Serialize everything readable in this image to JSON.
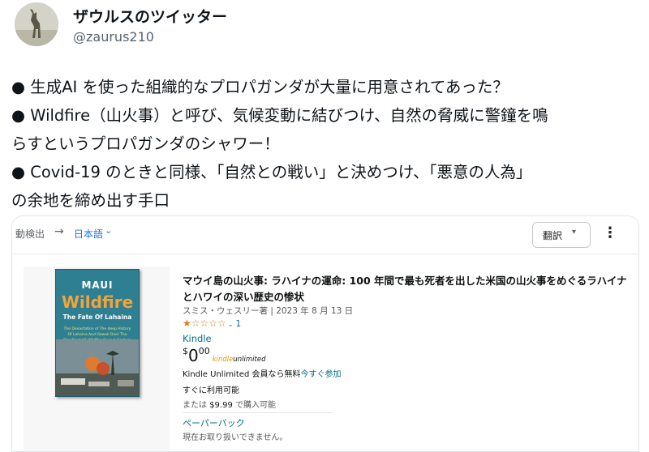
{
  "tweet": {
    "display_name": "ザウルスのツイッター",
    "handle": "@zaurus210",
    "lines": [
      "● 生成AI を使った組織的なプロパガンダが大量に用意されてあった？",
      "● Wildfire（山火事）と呼び、気候変動に結びつけ、自然の脅威に警鐘を鳴",
      "らすというプロパガンダのシャワー！",
      "● Covid-19 のときと同様、「自然との戦い」と決めつけ、「悪意の人為」",
      "の余地を締め出す手口"
    ]
  },
  "embed": {
    "toolbar": {
      "detect_label": "動検出",
      "arrow": "→",
      "language": "日本語",
      "translate_button": "翻訳",
      "more_icon": "more-vert-icon"
    },
    "product": {
      "cover": {
        "top": "MAUI",
        "title": "Wildfire",
        "subtitle": "The Fate Of Lahaina",
        "description": "The Devastation of The deep History Of Lahaina And Hawaii Over The Deadliest US Wildfire Over A Century"
      },
      "title": "マウイ島の山火事: ラハイナの運命: 100 年間で最も死者を出した米国の山火事をめぐるラハイナとハワイの深い歴史の惨状",
      "byline": "スミス・ウェスリー著 | 2023 年 8 月 13 日",
      "rating": 1,
      "rating_max": 5,
      "rating_count": "1",
      "format": "Kindle",
      "price": {
        "symbol": "$",
        "whole": "0",
        "fraction": "00"
      },
      "ku_logo": {
        "a": "kindle",
        "b": "unlimited"
      },
      "ku_text": "Kindle Unlimited 会員なら無料",
      "ku_link": "今すぐ参加",
      "availability": "すぐに利用可能",
      "alt_prefix": "または",
      "alt_amount": "$9.99",
      "alt_suffix": "で購入可能",
      "paperback": "ペーパーバック",
      "paperback_status": "現在お取り扱いできません。"
    }
  }
}
